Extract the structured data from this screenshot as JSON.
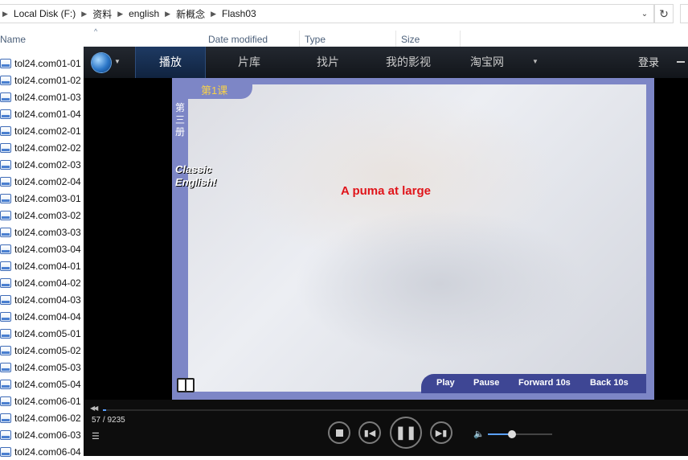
{
  "explorer": {
    "path": [
      "Local Disk (F:)",
      "资料",
      "english",
      "新概念",
      "Flash03"
    ],
    "columns": {
      "name": "Name",
      "date": "Date modified",
      "type": "Type",
      "size": "Size"
    },
    "files": [
      "tol24.com01-01",
      "tol24.com01-02",
      "tol24.com01-03",
      "tol24.com01-04",
      "tol24.com02-01",
      "tol24.com02-02",
      "tol24.com02-03",
      "tol24.com02-04",
      "tol24.com03-01",
      "tol24.com03-02",
      "tol24.com03-03",
      "tol24.com03-04",
      "tol24.com04-01",
      "tol24.com04-02",
      "tol24.com04-03",
      "tol24.com04-04",
      "tol24.com05-01",
      "tol24.com05-02",
      "tol24.com05-03",
      "tol24.com05-04",
      "tol24.com06-01",
      "tol24.com06-02",
      "tol24.com06-03",
      "tol24.com06-04"
    ]
  },
  "player": {
    "tabs": [
      "播放",
      "片库",
      "找片",
      "我的影视",
      "淘宝网"
    ],
    "active_tab": 0,
    "login": "登录",
    "video": {
      "lesson": "第1课",
      "side_cn": "第三册",
      "side_en": "Classic English!",
      "title": "A puma at large",
      "controls": [
        "Play",
        "Pause",
        "Forward 10s",
        "Back 10s"
      ]
    },
    "time": {
      "current": "57",
      "total": "/ 9235"
    },
    "progress": 0.006,
    "volume": 0.38,
    "accent": "#5aa0ff"
  }
}
